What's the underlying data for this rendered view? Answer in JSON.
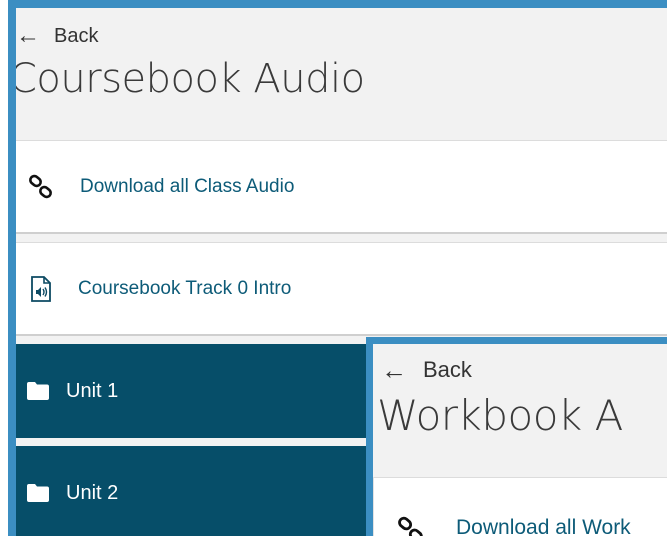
{
  "coursebook_panel": {
    "back_label": "Back",
    "back_icon": "arrow-left-icon",
    "title": "Coursebook Audio",
    "rows": [
      {
        "label": "Download all Class Audio",
        "icon": "link-icon",
        "style": "light"
      },
      {
        "label": "Coursebook Track 0 Intro",
        "icon": "audio-file-icon",
        "style": "light"
      },
      {
        "label": "Unit 1",
        "icon": "folder-icon",
        "style": "dark"
      },
      {
        "label": "Unit 2",
        "icon": "folder-icon",
        "style": "dark"
      }
    ]
  },
  "workbook_panel": {
    "back_label": "Back",
    "back_icon": "arrow-left-icon",
    "title": "Workbook A",
    "rows": [
      {
        "label": "Download all Work",
        "icon": "link-icon",
        "style": "light"
      }
    ]
  },
  "colors": {
    "panel_border": "#3b8ec2",
    "dark_row": "#064e69",
    "link_text": "#0d5b78",
    "background": "#f2f2f2"
  }
}
